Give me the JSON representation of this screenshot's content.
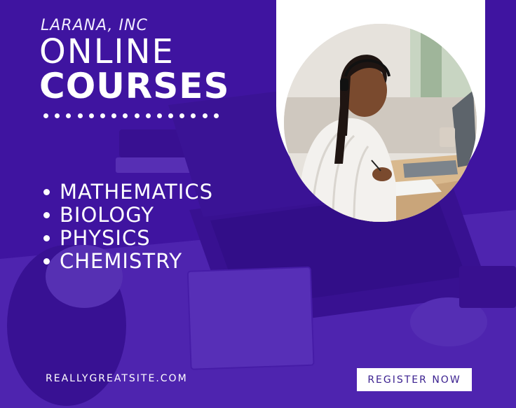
{
  "brand": "LARANA, INC",
  "title_line1": "ONLINE",
  "title_line2": "COURSES",
  "courses": [
    "MATHEMATICS",
    "BIOLOGY",
    "PHYSICS",
    "CHEMISTRY"
  ],
  "website": "REALLYGREATSITE.COM",
  "cta_label": "REGISTER NOW",
  "colors": {
    "background": "#4a1fa8",
    "accent_text": "#3a1f8f",
    "panel": "#ffffff"
  }
}
